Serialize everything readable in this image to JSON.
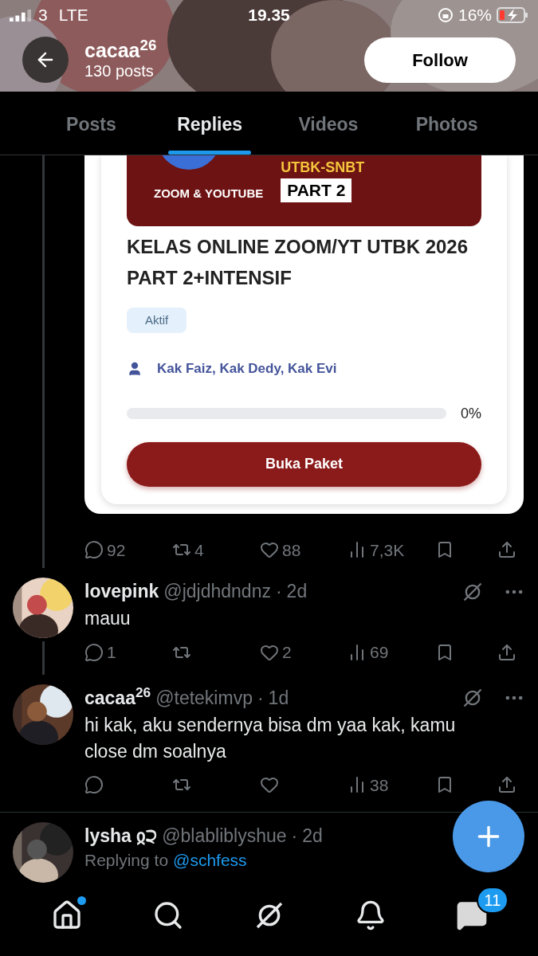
{
  "status_bar": {
    "carrier": "3",
    "network": "LTE",
    "time": "19.35",
    "battery": "16%"
  },
  "header": {
    "name": "cacaa$^{26}$",
    "posts": "130 posts",
    "follow_button": "Follow"
  },
  "tabs": [
    {
      "label": "Posts",
      "selected": false
    },
    {
      "label": "Replies",
      "selected": true
    },
    {
      "label": "Videos",
      "selected": false
    },
    {
      "label": "Photos",
      "selected": false
    }
  ],
  "course_card": {
    "banner_heading": "UTBK-SNBT",
    "banner_part": "PART 2",
    "banner_channels": "ZOOM & YOUTUBE",
    "title": "KELAS ONLINE ZOOM/YT UTBK 2026 PART 2+INTENSIF",
    "status_badge": "Aktif",
    "teachers": "Kak Faiz, Kak Dedy, Kak Evi",
    "progress": {
      "level": 0,
      "reading": "0%"
    },
    "button": "Buka Paket"
  },
  "post_stats": {
    "replies": "92",
    "reposts": "4",
    "likes": "88",
    "views": "7,3K"
  },
  "replies": [
    {
      "name": "lovepink",
      "handle": "@jdjdhdndnz",
      "separator": "·",
      "time": "2d",
      "text": "mauu",
      "thread_line": true,
      "stats": {
        "replies": "1",
        "likes": "2",
        "views": "69"
      }
    },
    {
      "name": "cacaa$^{26}$",
      "handle": "@tetekimvp",
      "separator": "·",
      "time": "1d",
      "text": "hi kak, aku sendernya bisa dm yaa kak, kamu close dm soalnya",
      "thread_line": false,
      "stats": {
        "views": "38"
      }
    },
    {
      "name": "lysha ჲ੨",
      "handle": "@blabliblyshue",
      "separator": "·",
      "time": "2d",
      "replying_prefix": "Replying to",
      "replying_to": "@schfess",
      "thread_line": false
    }
  ],
  "bottom_nav": [
    {
      "kind": "home",
      "dot": true
    },
    {
      "kind": "search"
    },
    {
      "kind": "grok"
    },
    {
      "kind": "notifications"
    },
    {
      "kind": "messages",
      "badge": "11"
    }
  ]
}
